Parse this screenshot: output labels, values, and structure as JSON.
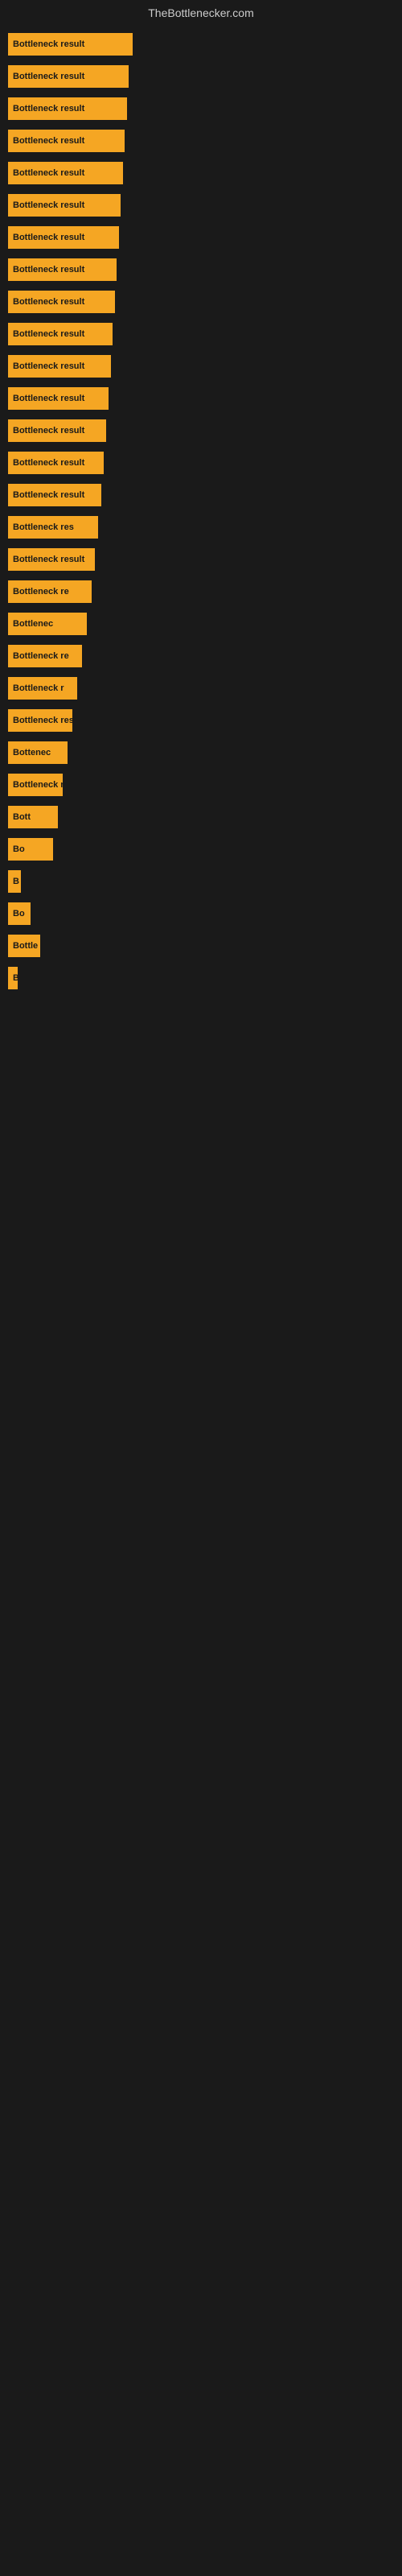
{
  "header": {
    "title": "TheBottlenecker.com"
  },
  "rows": [
    {
      "label": "Bottleneck result",
      "width": 155
    },
    {
      "label": "Bottleneck result",
      "width": 150
    },
    {
      "label": "Bottleneck result",
      "width": 148
    },
    {
      "label": "Bottleneck result",
      "width": 145
    },
    {
      "label": "Bottleneck result",
      "width": 143
    },
    {
      "label": "Bottleneck result",
      "width": 140
    },
    {
      "label": "Bottleneck result",
      "width": 138
    },
    {
      "label": "Bottleneck result",
      "width": 135
    },
    {
      "label": "Bottleneck result",
      "width": 133
    },
    {
      "label": "Bottleneck result",
      "width": 130
    },
    {
      "label": "Bottleneck result",
      "width": 128
    },
    {
      "label": "Bottleneck result",
      "width": 125
    },
    {
      "label": "Bottleneck result",
      "width": 122
    },
    {
      "label": "Bottleneck result",
      "width": 119
    },
    {
      "label": "Bottleneck result",
      "width": 116
    },
    {
      "label": "Bottleneck res",
      "width": 112
    },
    {
      "label": "Bottleneck result",
      "width": 108
    },
    {
      "label": "Bottleneck re",
      "width": 104
    },
    {
      "label": "Bottlenec",
      "width": 98
    },
    {
      "label": "Bottleneck re",
      "width": 92
    },
    {
      "label": "Bottleneck r",
      "width": 86
    },
    {
      "label": "Bottleneck resu",
      "width": 80
    },
    {
      "label": "Bottenec",
      "width": 74
    },
    {
      "label": "Bottleneck r",
      "width": 68
    },
    {
      "label": "Bott",
      "width": 62
    },
    {
      "label": "Bo",
      "width": 56
    },
    {
      "label": "B",
      "width": 16
    },
    {
      "label": "Bo",
      "width": 28
    },
    {
      "label": "Bottle",
      "width": 40
    },
    {
      "label": "B",
      "width": 8
    },
    {
      "label": "",
      "width": 0
    },
    {
      "label": "",
      "width": 0
    },
    {
      "label": "",
      "width": 0
    },
    {
      "label": "",
      "width": 0
    },
    {
      "label": "",
      "width": 0
    },
    {
      "label": "",
      "width": 0
    }
  ],
  "accent_color": "#f5a623",
  "background_color": "#1a1a1a"
}
